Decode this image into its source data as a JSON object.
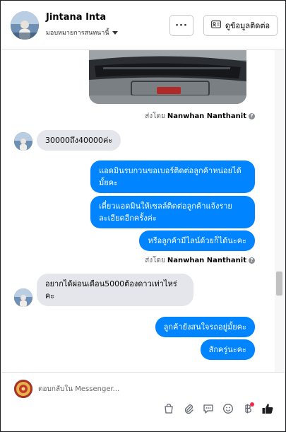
{
  "header": {
    "contact_name": "Jintana Inta",
    "assign_label": "มอบหมายการสนทนานี้",
    "more_label": "···",
    "contact_info_label": "ดูข้อมูลติดต่อ"
  },
  "sender_name": "Nanwhan Nanthanit",
  "sent_by_prefix": "ส่งโดย",
  "messages": [
    {
      "dir": "in",
      "text": "30000ถึง40000ค่ะ"
    },
    {
      "dir": "out",
      "text": "แอดมินรบกวนขอเบอร์ติดต่อลูกค้าหน่อยได้มั้ยคะ"
    },
    {
      "dir": "out",
      "text": "เดี๋ยวแอดมินให้เซลล์ติดต่อลูกค้าแจ้งรายละเอียดอีกครั้งค่ะ"
    },
    {
      "dir": "out",
      "text": "หรือลูกค้ามีไลน์ด้วยก็ได้นะคะ"
    },
    {
      "dir": "in",
      "text": "อยากได้ผ่อนเดือน5000ต้องดาวเท่าไหร่คะ"
    },
    {
      "dir": "out",
      "text": "ลูกค้ายังสนใจรถอยู่มั้ยคะ"
    },
    {
      "dir": "out",
      "text": "สักครู่นะคะ"
    }
  ],
  "composer": {
    "placeholder": "ตอบกลับใน Messenger..."
  },
  "icons": [
    "contact-card-icon",
    "caret-down-icon",
    "info-icon",
    "shopping-bag-icon",
    "paperclip-icon",
    "saved-reply-icon",
    "emoji-icon",
    "baht-icon",
    "thumbs-up-icon"
  ],
  "colors": {
    "outgoing_bubble": "#0084ff",
    "incoming_bubble": "#e4e6eb",
    "notification_dot": "#f02849"
  }
}
